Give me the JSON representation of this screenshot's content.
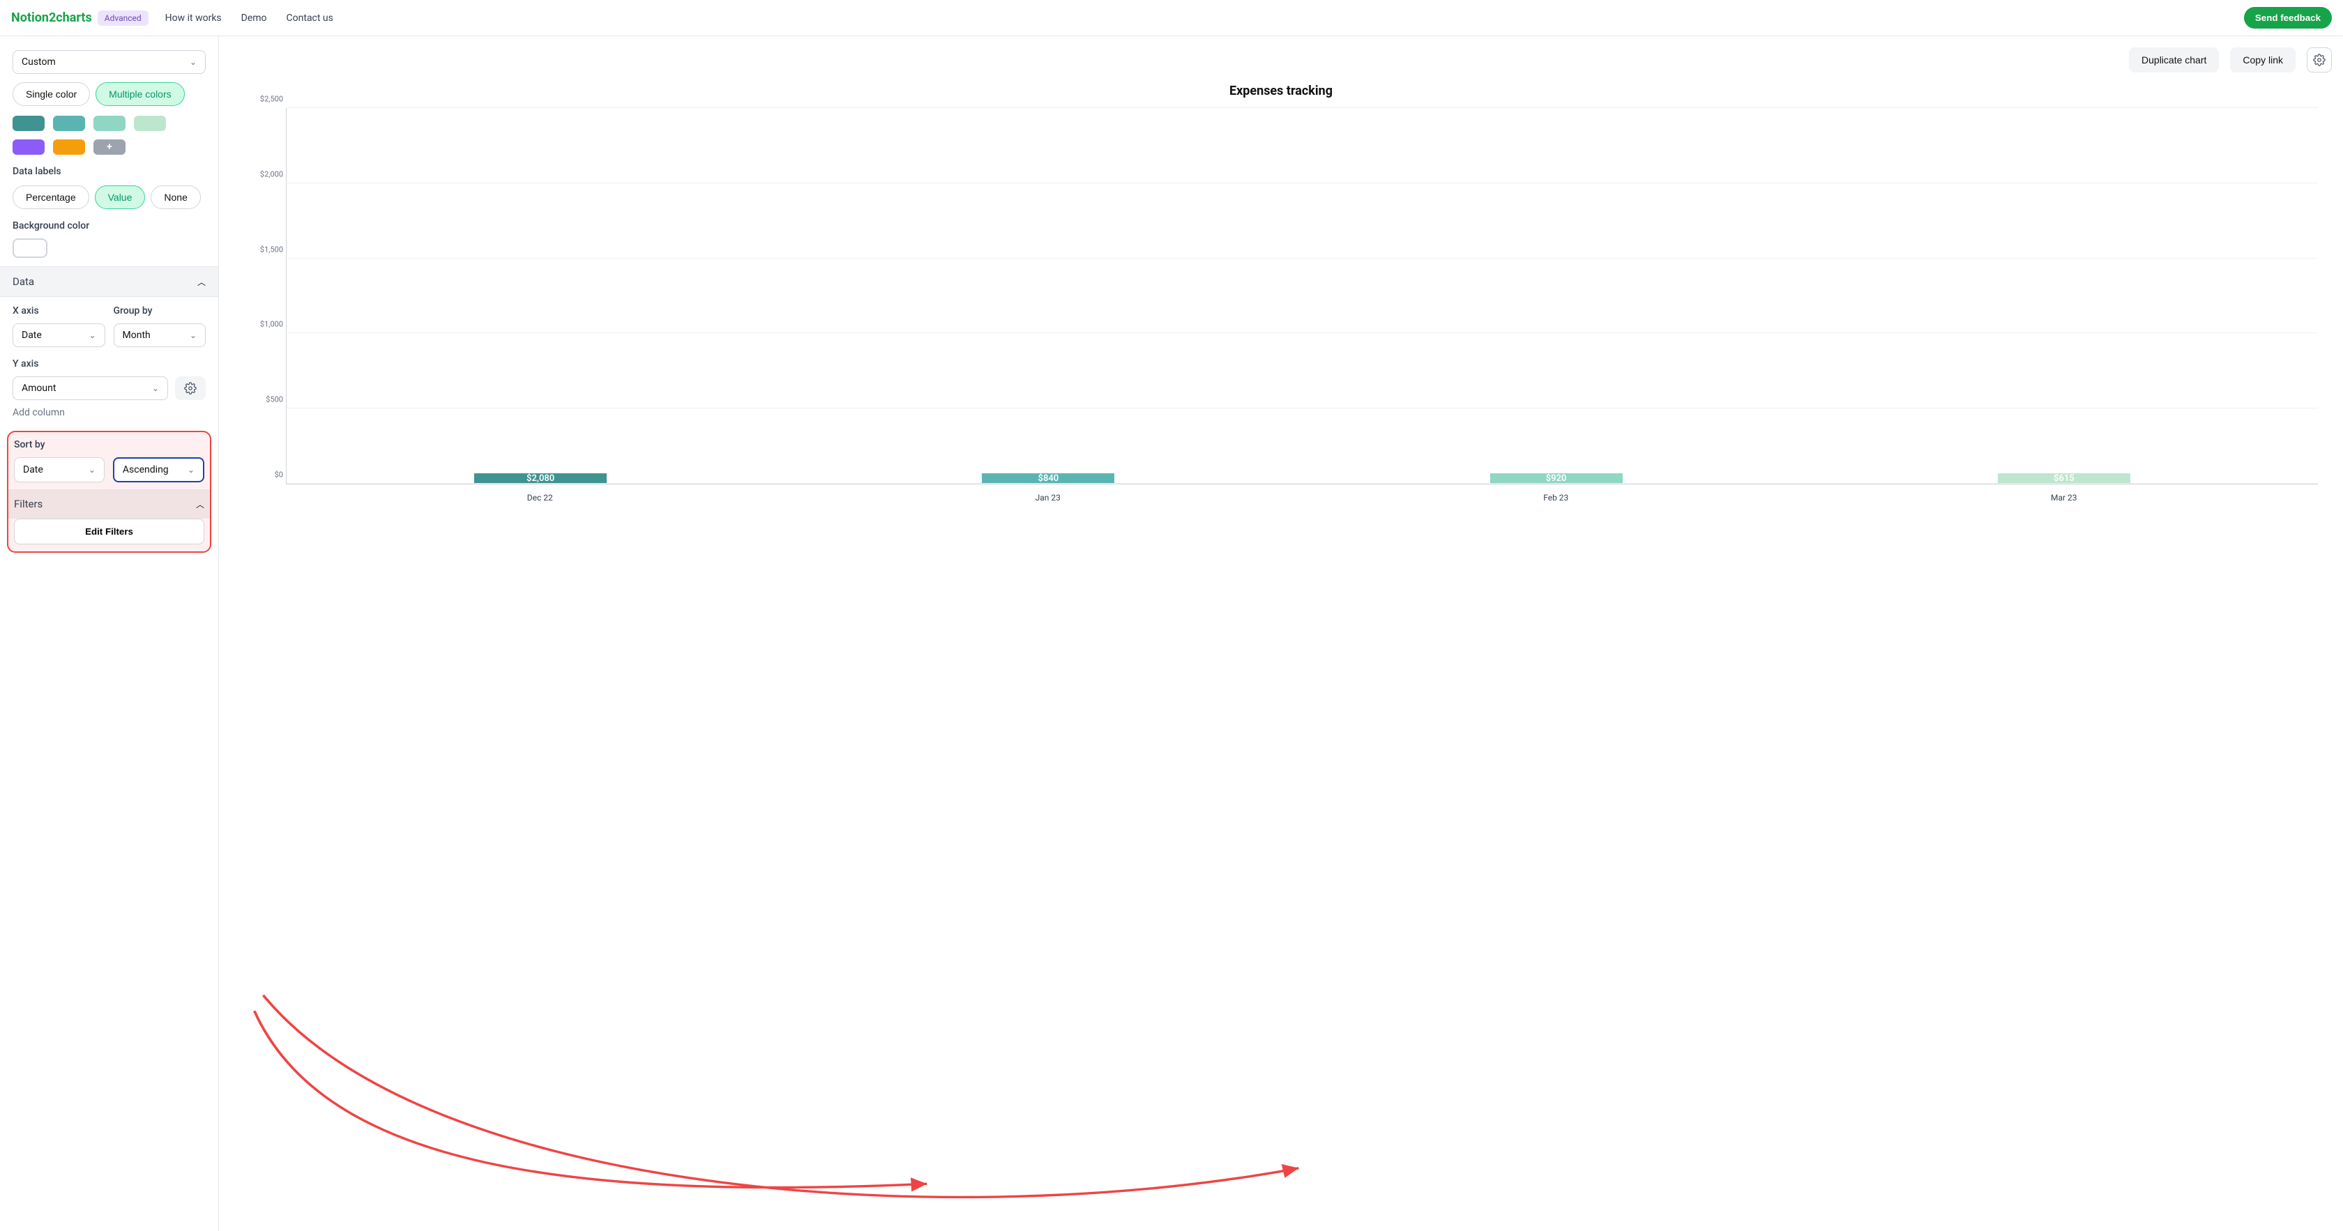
{
  "nav": {
    "brand": "Notion2charts",
    "badge": "Advanced",
    "links": [
      "How it works",
      "Demo",
      "Contact us"
    ],
    "feedback": "Send feedback"
  },
  "sidebar": {
    "palette_select": "Custom",
    "color_mode": {
      "single": "Single color",
      "multiple": "Multiple colors"
    },
    "swatches": [
      "#3F9391",
      "#5AB5B2",
      "#8FD6C3",
      "#BDE6CF",
      "#8B5CF6",
      "#F59E0B"
    ],
    "data_labels_title": "Data labels",
    "data_labels": {
      "percentage": "Percentage",
      "value": "Value",
      "none": "None"
    },
    "bgcolor_title": "Background color",
    "data_section": "Data",
    "xaxis_title": "X axis",
    "xaxis_value": "Date",
    "groupby_title": "Group by",
    "groupby_value": "Month",
    "yaxis_title": "Y axis",
    "yaxis_value": "Amount",
    "add_column": "Add column",
    "sortby_title": "Sort by",
    "sortby_field": "Date",
    "sortby_dir": "Ascending",
    "filters_title": "Filters",
    "edit_filters": "Edit Filters"
  },
  "toolbar": {
    "duplicate": "Duplicate chart",
    "copylink": "Copy link"
  },
  "chart_data": {
    "type": "bar",
    "title": "Expenses tracking",
    "categories": [
      "Dec 22",
      "Jan 23",
      "Feb 23",
      "Mar 23"
    ],
    "values": [
      2080,
      840,
      920,
      615
    ],
    "value_labels": [
      "$2,080",
      "$840",
      "$920",
      "$615"
    ],
    "colors": [
      "#3F9391",
      "#5AB5B2",
      "#8FD6C3",
      "#BDE6CF"
    ],
    "ylim": [
      0,
      2500
    ],
    "yticks": [
      0,
      500,
      1000,
      1500,
      2000,
      2500
    ],
    "ytick_labels": [
      "$0",
      "$500",
      "$1,000",
      "$1,500",
      "$2,000",
      "$2,500"
    ],
    "xlabel": "",
    "ylabel": ""
  }
}
